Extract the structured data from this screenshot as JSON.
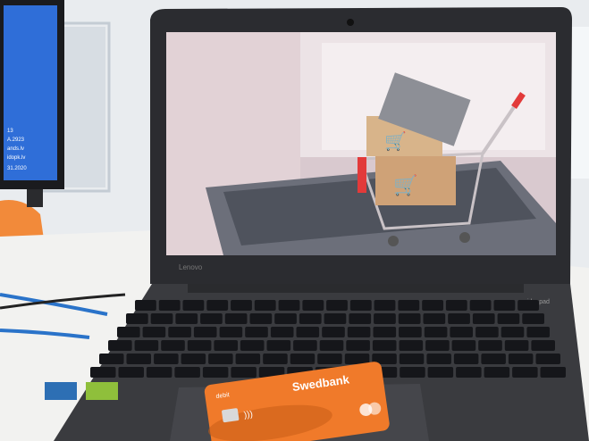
{
  "photo": {
    "laptop_brand": "Lenovo",
    "laptop_model": "ideapad",
    "card_brand": "Swedbank",
    "card_type": "debit",
    "monitor_text_lines": [
      "13",
      "A.2923",
      "ands.lv",
      "idopk.lv",
      "31.2020"
    ]
  },
  "colors": {
    "wall": "#e9ecef",
    "desk": "#f2f2f0",
    "laptop_body": "#3a3b3f",
    "bezel": "#1d1e21",
    "screen_bg": "#d9c9cf",
    "card": "#f07a2a",
    "cart_handle": "#e23a3a",
    "monitor_screen": "#2f6ed8",
    "cable": "#2a73c9",
    "chair": "#f28a3a"
  }
}
